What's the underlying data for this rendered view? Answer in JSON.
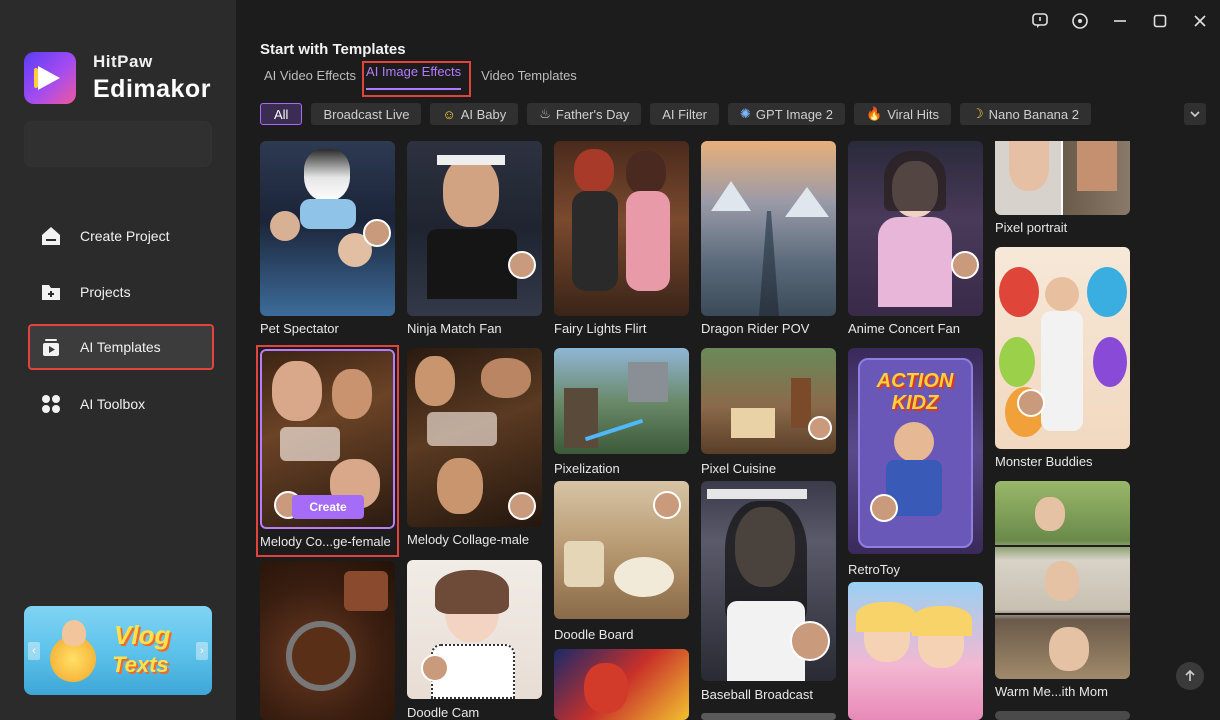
{
  "app": {
    "brand_top": "HitPaw",
    "brand_main": "Edimakor"
  },
  "sidebar": {
    "items": [
      {
        "label": "Create Project",
        "icon": "home-icon"
      },
      {
        "label": "Projects",
        "icon": "folder-icon"
      },
      {
        "label": "AI Templates",
        "icon": "templates-icon",
        "active": true
      },
      {
        "label": "AI Toolbox",
        "icon": "toolbox-icon"
      }
    ],
    "banner": {
      "line1": "Vlog",
      "line2": "Texts"
    }
  },
  "header": {
    "title": "Start with Templates",
    "tabs": [
      {
        "label": "AI Video Effects"
      },
      {
        "label": "AI Image Effects",
        "active": true
      },
      {
        "label": "Video Templates"
      }
    ]
  },
  "chips": [
    {
      "label": "All",
      "active": true
    },
    {
      "label": "Broadcast Live"
    },
    {
      "label": "AI Baby",
      "icon": "☺"
    },
    {
      "label": "Father's Day",
      "icon": "♨"
    },
    {
      "label": "AI Filter"
    },
    {
      "label": "GPT Image 2",
      "icon": "✺"
    },
    {
      "label": "Viral Hits",
      "icon": "🔥"
    },
    {
      "label": "Nano Banana 2",
      "icon": "☽"
    }
  ],
  "cards": {
    "pet_spectator": "Pet Spectator",
    "ninja_match_fan": "Ninja Match Fan",
    "fairy_lights_flirt": "Fairy Lights Flirt",
    "dragon_rider_pov": "Dragon Rider POV",
    "anime_concert_fan": "Anime Concert Fan",
    "pixel_portrait": "Pixel portrait",
    "melody_female": "Melody Co...ge-female",
    "melody_male": "Melody Collage-male",
    "pixelization": "Pixelization",
    "pixel_cuisine": "Pixel Cuisine",
    "retrotoy": "RetroToy",
    "monster_buddies": "Monster Buddies",
    "doodle_board": "Doodle Board",
    "baseball_broadcast": "Baseball Broadcast",
    "warm_mom": "Warm Me...ith Mom",
    "doodle_cam": "Doodle Cam",
    "create_label": "Create",
    "toy_brand": "ACTION KIDZ"
  },
  "colors": {
    "accent": "#a46cf7",
    "highlight": "#e0443c"
  }
}
